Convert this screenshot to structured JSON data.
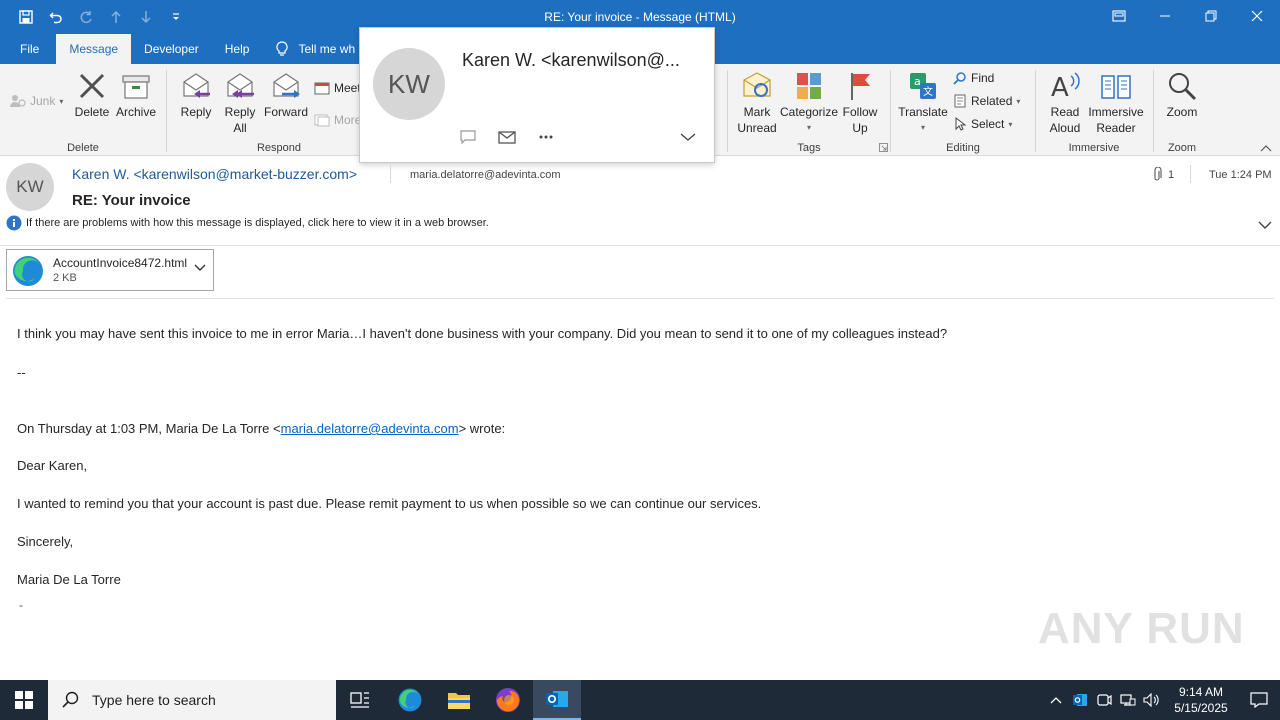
{
  "window": {
    "title": "RE: Your invoice  -  Message (HTML)"
  },
  "ribbon_tabs": [
    "File",
    "Message",
    "Developer",
    "Help"
  ],
  "tell_me": "Tell me wh",
  "ribbon": {
    "delete_group": {
      "label": "Delete",
      "junk": "Junk",
      "delete": "Delete",
      "archive": "Archive"
    },
    "respond_group": {
      "label": "Respond",
      "reply": "Reply",
      "reply_all_1": "Reply",
      "reply_all_2": "All",
      "forward": "Forward",
      "meeting": "Meet",
      "more": "More"
    },
    "tags_group": {
      "label": "Tags",
      "mark_unread_1": "Mark",
      "mark_unread_2": "Unread",
      "categorize": "Categorize",
      "follow_up_1": "Follow",
      "follow_up_2": "Up"
    },
    "editing_group": {
      "label": "Editing",
      "translate": "Translate",
      "find": "Find",
      "related": "Related",
      "select": "Select"
    },
    "immersive_group": {
      "label": "Immersive",
      "read_aloud_1": "Read",
      "read_aloud_2": "Aloud",
      "immersive_reader_1": "Immersive",
      "immersive_reader_2": "Reader"
    },
    "zoom_group": {
      "label": "Zoom",
      "zoom": "Zoom"
    }
  },
  "contact_card": {
    "initials": "KW",
    "name": "Karen W. <karenwilson@..."
  },
  "message": {
    "initials": "KW",
    "sender": "Karen W. <karenwilson@market-buzzer.com>",
    "to": "maria.delatorre@adevinta.com",
    "attachment_count": "1",
    "date": "Tue 1:24 PM",
    "subject": "RE: Your invoice",
    "info_bar": "If there are problems with how this message is displayed, click here to view it in a web browser.",
    "attachment": {
      "name": "AccountInvoice8472.html",
      "size": "2 KB"
    },
    "body": {
      "line1": "I think you may have sent this invoice to me in error Maria…I haven't done business with your company. Did you mean to send it to one of my colleagues instead?",
      "sig": "--",
      "quote_prefix": "On Thursday at 1:03 PM, Maria De La Torre <",
      "quote_email": "maria.delatorre@adevinta.com",
      "quote_suffix": "> wrote:",
      "greeting": "Dear Karen,",
      "paragraph": "I wanted to remind you that your account is past due. Please remit payment to us when possible so we can continue our services.",
      "closing": "Sincerely,",
      "signature": "Maria De La Torre",
      "dash": "-"
    }
  },
  "watermark": "ANY RUN",
  "taskbar": {
    "search_placeholder": "Type here to search",
    "time": "9:14 AM",
    "date": "5/15/2025"
  }
}
